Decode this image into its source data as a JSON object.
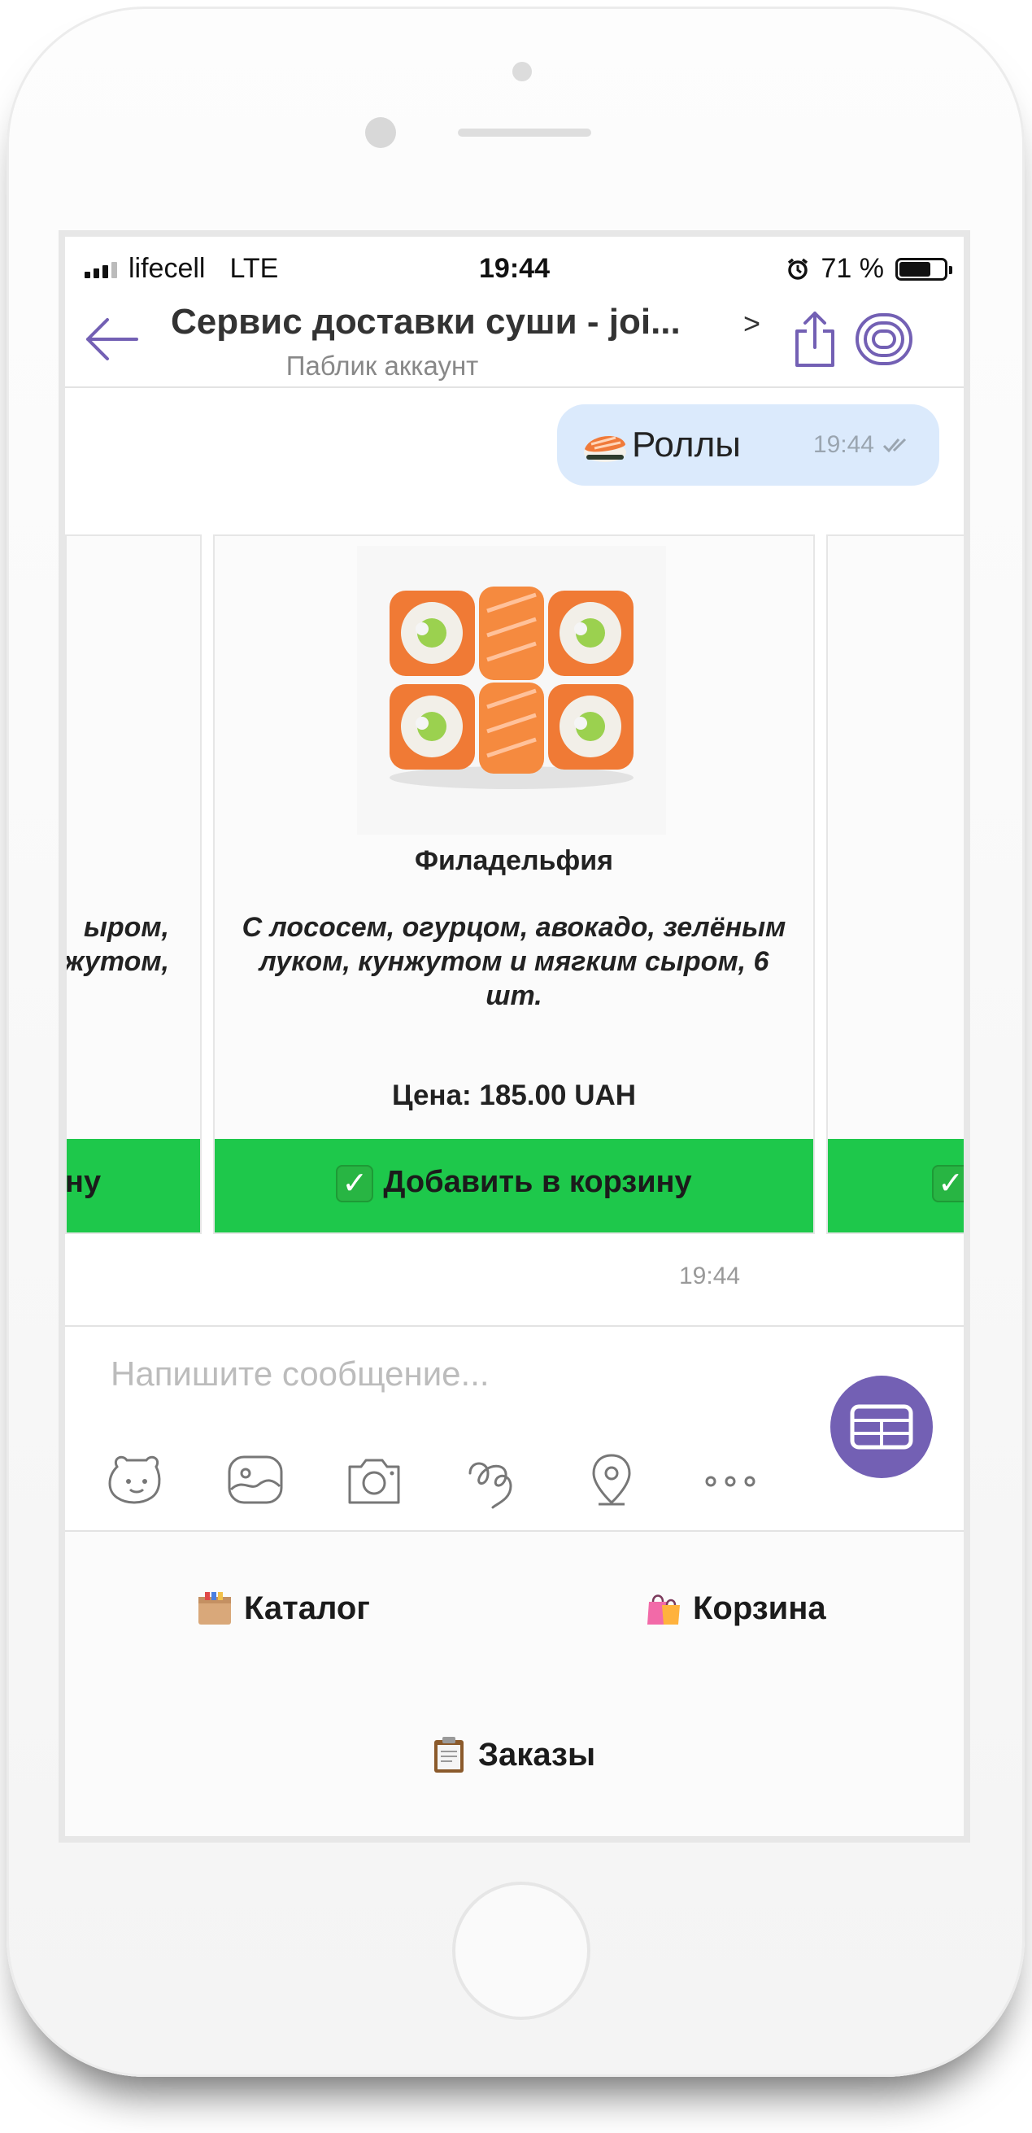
{
  "status_bar": {
    "carrier": "lifecell",
    "network": "LTE",
    "time": "19:44",
    "battery_percent": "71 %",
    "battery_level": 0.71
  },
  "header": {
    "title": "Сервис доставки суши - joi...",
    "chevron": ">",
    "subtitle": "Паблик аккаунт",
    "accent_color": "#7360b4"
  },
  "outgoing_message": {
    "emoji_icon": "sushi-emoji-icon",
    "text": "Роллы",
    "time": "19:44"
  },
  "carousel": {
    "left_card": {
      "desc_lines": [
        "ыром,",
        "жутом,"
      ],
      "button_label": "ну"
    },
    "center_card": {
      "name": "Филадельфия",
      "description": "С лососем, огурцом, авокадо, зелёным луком, кунжутом и мягким сыром, 6 шт.",
      "price": "Цена: 185.00 UAH",
      "button_label": "Добавить в корзину",
      "button_emoji": "✓"
    },
    "right_card": {
      "button_emoji": "✓"
    },
    "button_color": "#1ec84b",
    "time": "19:44"
  },
  "composer": {
    "placeholder": "Напишите сообщение...",
    "tools": [
      "sticker-icon",
      "gallery-icon",
      "camera-icon",
      "doodle-icon",
      "location-icon",
      "more-icon"
    ]
  },
  "bot_menu": {
    "catalog": "Каталог",
    "cart": "Корзина",
    "orders": "Заказы"
  }
}
